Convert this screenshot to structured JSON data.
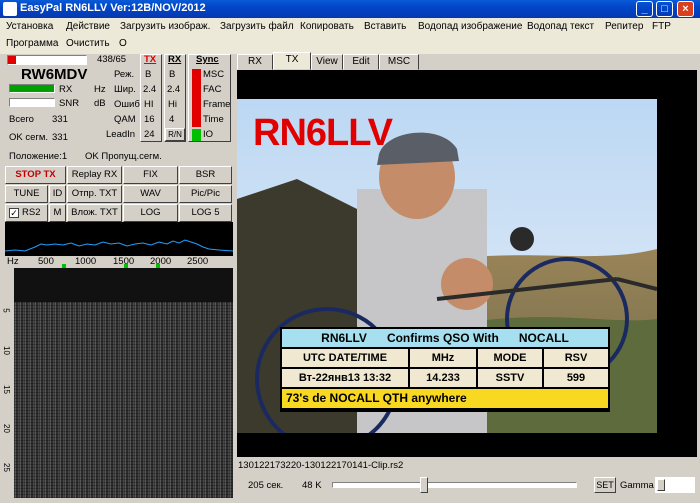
{
  "window": {
    "title": "EasyPal  RN6LLV   Ver:12B/NOV/2012",
    "min": "_",
    "max": "□",
    "close": "×"
  },
  "menu": {
    "row1": [
      "Установка",
      "Действие",
      "Загрузить изображ.",
      "Загрузить файл",
      "Копировать",
      "Вставить",
      "Водопад изображение",
      "Водопад текст",
      "Репитер",
      "FTP"
    ],
    "row2": [
      "Программа",
      "Очистить",
      "O"
    ]
  },
  "status": {
    "progress_text": "438/65",
    "progress_fraction": 0.1,
    "callsign": "RW6MDV",
    "rx_label": "RX",
    "snr_label": "SNR",
    "hz_label": "Hz",
    "db_label": "dB",
    "mode_labels": [
      "Реж.",
      "Шир.",
      "Ошиб",
      "QAM",
      "LeadIn"
    ],
    "tx_header": "TX",
    "tx_values": [
      "B",
      "2.4",
      "HI",
      "16",
      "24"
    ],
    "rx_header": "RX",
    "rx_values": [
      "B",
      "2.4",
      "Hi",
      "4",
      "R/N"
    ],
    "sync_header": "Sync",
    "sync_labels": [
      "MSC",
      "FAC",
      "Frame",
      "Time",
      "IO"
    ],
    "total_label": "Всего",
    "total_value": "331",
    "ok_label": "OK сегм.",
    "ok_value": "331",
    "position_label": "Положение:1",
    "ok_missed_label": "OK Пропущ.сегм."
  },
  "buttons": {
    "stop_tx": "STOP TX",
    "replay_rx": "Replay RX",
    "fix": "FIX",
    "bsr": "BSR",
    "tune": "TUNE",
    "id": "ID",
    "send_txt": "Отпр. TXT",
    "wav": "WAV",
    "picpic": "Pic/Pic",
    "rs2": "RS2",
    "m": "M",
    "attach_txt": "Влож. TXT",
    "log": "LOG",
    "log5": "LOG 5"
  },
  "spectrum": {
    "axis_unit": "Hz",
    "ticks": [
      "500",
      "1000",
      "1500",
      "2000",
      "2500"
    ]
  },
  "waterfall": {
    "scale": [
      "5",
      "10",
      "15",
      "20",
      "25"
    ]
  },
  "tabs": [
    "RX",
    "TX",
    "View",
    "Edit",
    "MSC"
  ],
  "active_tab": "TX",
  "image": {
    "callsign_overlay": "RN6LLV",
    "qso_header": "RN6LLV      Confirms QSO With      NOCALL",
    "columns": [
      "UTC DATE/TIME",
      "MHz",
      "MODE",
      "RSV"
    ],
    "values": [
      "Вт-22янв13 13:32",
      "14.233",
      "SSTV",
      "599"
    ],
    "footer": "73's de NOCALL QTH anywhere"
  },
  "filename": "130122173220-130122170141-Clip.rs2",
  "bottombar": {
    "seconds": "205 сек.",
    "size": "48 K",
    "set": "SET",
    "gamma": "Gamma"
  },
  "colors": {
    "accent_blue": "#0046c8",
    "red": "#e00000",
    "green": "#00a000",
    "qso_blue": "#a6e0f0",
    "qso_yellow": "#f8d820"
  }
}
